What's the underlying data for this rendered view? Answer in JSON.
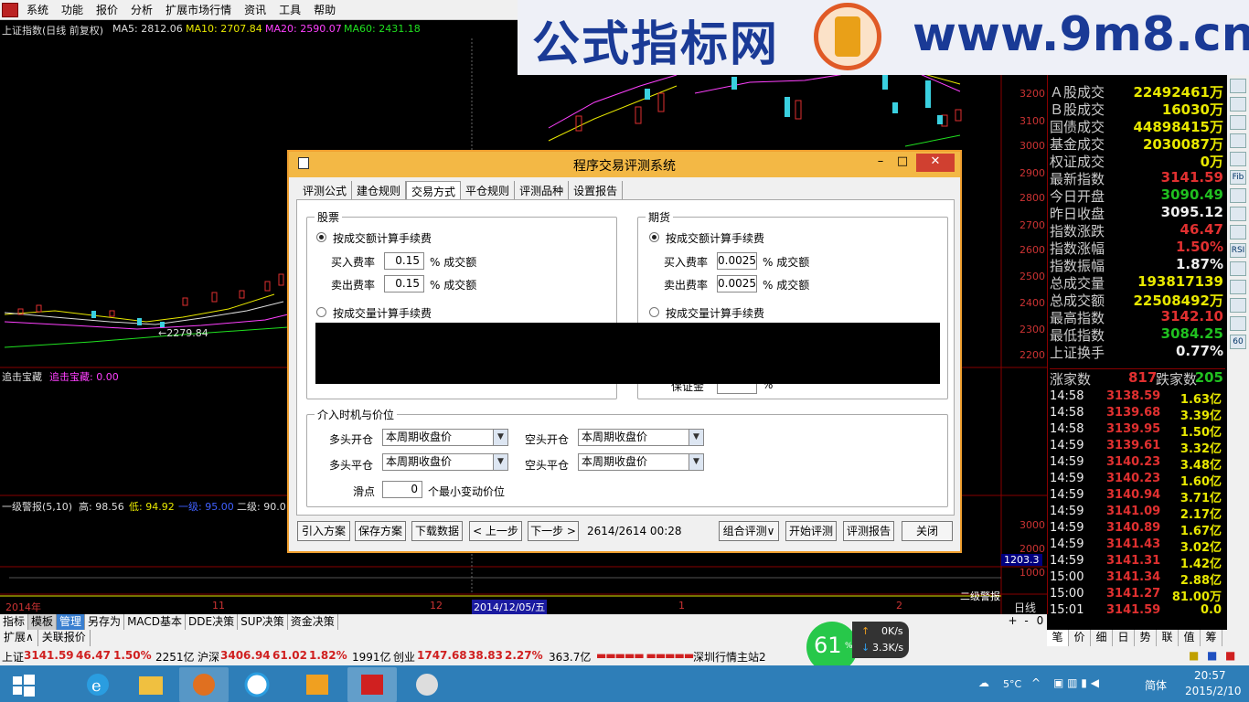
{
  "menu": {
    "items": [
      "系统",
      "功能",
      "报价",
      "分析",
      "扩展市场行情",
      "资讯",
      "工具",
      "帮助"
    ]
  },
  "banner": {
    "title": "公式指标网",
    "url": "www.9m8.cn",
    "seal_text": "9m8.cn"
  },
  "chart": {
    "header": {
      "name": "上证指数(日线 前复权)",
      "ma5": "MA5: 2812.06",
      "ma10": "MA10: 2707.84",
      "ma20": "MA20: 2590.07",
      "ma60": "MA60: 2431.18"
    },
    "low_label": "←2279.84",
    "ind1": {
      "name": "追击宝藏",
      "value": "追击宝藏: 0.00"
    },
    "ind2": {
      "name": "一级警报(5,10)",
      "high": "高: 98.56",
      "low": "低: 94.92",
      "level1": "一级: 95.00",
      "level2": "二级: 90.0"
    },
    "y_axis": [
      "3200",
      "3100",
      "3000",
      "2900",
      "2800",
      "2700",
      "2600",
      "2500",
      "2400",
      "2300",
      "2200"
    ],
    "vol_axis": [
      "3000",
      "2000",
      "1000"
    ],
    "vol_mark": "1203.3",
    "sub_mark": "二级警报",
    "x_labels": [
      "2014年",
      "11",
      "12",
      "2014/12/05/五",
      "1",
      "2"
    ],
    "period": "日线",
    "zoom_buttons": [
      "+",
      "-",
      "0"
    ]
  },
  "right_panel": {
    "stats": [
      {
        "k": "Ａ股成交",
        "v": "22492461万",
        "c": "#e8e800"
      },
      {
        "k": "Ｂ股成交",
        "v": "16030万",
        "c": "#e8e800"
      },
      {
        "k": "国债成交",
        "v": "44898415万",
        "c": "#e8e800"
      },
      {
        "k": "基金成交",
        "v": "2030087万",
        "c": "#e8e800"
      },
      {
        "k": "权证成交",
        "v": "0万",
        "c": "#e8e800"
      },
      {
        "k": "最新指数",
        "v": "3141.59",
        "c": "#e03030"
      },
      {
        "k": "今日开盘",
        "v": "3090.49",
        "c": "#20c020"
      },
      {
        "k": "昨日收盘",
        "v": "3095.12",
        "c": "#eeeeee"
      },
      {
        "k": "指数涨跌",
        "v": "46.47",
        "c": "#e03030"
      },
      {
        "k": "指数涨幅",
        "v": "1.50%",
        "c": "#e03030"
      },
      {
        "k": "指数振幅",
        "v": "1.87%",
        "c": "#eeeeee"
      },
      {
        "k": "总成交量",
        "v": "193817139",
        "c": "#e8e800"
      },
      {
        "k": "总成交额",
        "v": "22508492万",
        "c": "#e8e800"
      },
      {
        "k": "最高指数",
        "v": "3142.10",
        "c": "#e03030"
      },
      {
        "k": "最低指数",
        "v": "3084.25",
        "c": "#20c020"
      },
      {
        "k": "上证换手",
        "v": "0.77%",
        "c": "#eeeeee"
      }
    ],
    "breadth": {
      "up_label": "涨家数",
      "up": "817",
      "down_label": "跌家数",
      "down": "205"
    },
    "ticks": [
      {
        "t": "14:58",
        "p": "3138.59",
        "a": "1.63亿"
      },
      {
        "t": "14:58",
        "p": "3139.68",
        "a": "3.39亿"
      },
      {
        "t": "14:58",
        "p": "3139.95",
        "a": "1.50亿"
      },
      {
        "t": "14:59",
        "p": "3139.61",
        "a": "3.32亿"
      },
      {
        "t": "14:59",
        "p": "3140.23",
        "a": "3.48亿"
      },
      {
        "t": "14:59",
        "p": "3140.23",
        "a": "1.60亿"
      },
      {
        "t": "14:59",
        "p": "3140.94",
        "a": "3.71亿"
      },
      {
        "t": "14:59",
        "p": "3141.09",
        "a": "2.17亿"
      },
      {
        "t": "14:59",
        "p": "3140.89",
        "a": "1.67亿"
      },
      {
        "t": "14:59",
        "p": "3141.43",
        "a": "3.02亿"
      },
      {
        "t": "14:59",
        "p": "3141.31",
        "a": "1.42亿"
      },
      {
        "t": "15:00",
        "p": "3141.34",
        "a": "2.88亿"
      },
      {
        "t": "15:00",
        "p": "3141.27",
        "a": "81.00万"
      },
      {
        "t": "15:01",
        "p": "3141.59",
        "a": "0.0"
      }
    ],
    "tabs": [
      "笔",
      "价",
      "细",
      "日",
      "势",
      "联",
      "值",
      "筹"
    ]
  },
  "right_toolbar": [
    "RSI",
    "Fib",
    "60"
  ],
  "tabs1": [
    "指标",
    "模板",
    "管理",
    "另存为",
    "MACD基本",
    "DDE决策",
    "SUP决策",
    "资金决策"
  ],
  "tabs2": [
    "扩展∧",
    "关联报价"
  ],
  "status": {
    "sh_label": "上证",
    "sh": "3141.59",
    "sh_chg": "46.47",
    "sh_pct": "1.50%",
    "sh_amt": "2251亿",
    "sz_label": "沪深",
    "sz": "3406.94",
    "sz_chg": "61.02",
    "sz_pct": "1.82%",
    "sz_amt": "1991亿",
    "cy_label": "创业",
    "cy": "1747.68",
    "cy_chg": "38.83",
    "cy_pct": "2.27%",
    "cy_amt": "363.7亿",
    "server": "深圳行情主站2"
  },
  "net_widget": {
    "percent": "61",
    "pct_sign": "%",
    "up": "0K/s",
    "down": "3.3K/s"
  },
  "taskbar": {
    "weather": "5°C",
    "ime": "简体",
    "time": "20:57",
    "date": "2015/2/10"
  },
  "dialog": {
    "title": "程序交易评测系统",
    "controls": [
      "–",
      "□",
      "✕"
    ],
    "tabs": [
      "评测公式",
      "建仓规则",
      "交易方式",
      "平仓规则",
      "评测品种",
      "设置报告"
    ],
    "active_tab": 2,
    "stock": {
      "title": "股票",
      "opt_amount": "按成交额计算手续费",
      "buy_label": "买入费率",
      "buy_value": "0.15",
      "buy_unit": "% 成交额",
      "sell_label": "卖出费率",
      "sell_value": "0.15",
      "sell_unit": "% 成交额",
      "opt_volume": "按成交量计算手续费"
    },
    "futures": {
      "title": "期货",
      "opt_amount": "按成交额计算手续费",
      "buy_label": "买入费率",
      "buy_value": "0.0025",
      "buy_unit": "% 成交额",
      "sell_label": "卖出费率",
      "sell_value": "0.0025",
      "sell_unit": "% 成交额",
      "opt_volume": "按成交量计算手续费",
      "margin_label": "保证金",
      "margin_unit": "%"
    },
    "entry": {
      "title": "介入时机与价位",
      "long_open": "多头开仓",
      "long_open_val": "本周期收盘价",
      "long_close": "多头平仓",
      "long_close_val": "本周期收盘价",
      "short_open": "空头开仓",
      "short_open_val": "本周期收盘价",
      "short_close": "空头平仓",
      "short_close_val": "本周期收盘价",
      "slip_label": "滑点",
      "slip_value": "0",
      "slip_unit": "个最小变动价位"
    },
    "buttons": {
      "import": "引入方案",
      "save": "保存方案",
      "download": "下载数据",
      "prev": "< 上一步",
      "next": "下一步 >",
      "progress": "2614/2614 00:28",
      "combo": "组合评测∨",
      "start": "开始评测",
      "report": "评测报告",
      "close": "关闭"
    }
  }
}
